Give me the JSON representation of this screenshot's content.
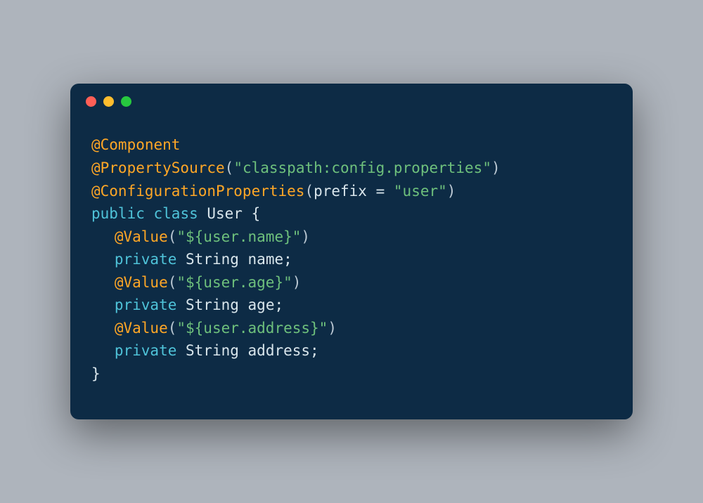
{
  "code": {
    "lines": [
      {
        "indent": 0,
        "tokens": [
          {
            "cls": "annotation",
            "t": "@Component"
          }
        ]
      },
      {
        "indent": 0,
        "tokens": [
          {
            "cls": "annotation",
            "t": "@PropertySource"
          },
          {
            "cls": "paren",
            "t": "("
          },
          {
            "cls": "string",
            "t": "\"classpath:config.properties\""
          },
          {
            "cls": "paren",
            "t": ")"
          }
        ]
      },
      {
        "indent": 0,
        "tokens": [
          {
            "cls": "annotation",
            "t": "@ConfigurationProperties"
          },
          {
            "cls": "paren",
            "t": "("
          },
          {
            "cls": "param",
            "t": "prefix "
          },
          {
            "cls": "op",
            "t": "= "
          },
          {
            "cls": "string",
            "t": "\"user\""
          },
          {
            "cls": "paren",
            "t": ")"
          }
        ]
      },
      {
        "indent": 0,
        "tokens": [
          {
            "cls": "keyword",
            "t": "public "
          },
          {
            "cls": "keyword",
            "t": "class "
          },
          {
            "cls": "type",
            "t": "User "
          },
          {
            "cls": "brace",
            "t": "{"
          }
        ]
      },
      {
        "indent": 1,
        "tokens": [
          {
            "cls": "annotation",
            "t": "@Value"
          },
          {
            "cls": "paren",
            "t": "("
          },
          {
            "cls": "string",
            "t": "\"${user.name}\""
          },
          {
            "cls": "paren",
            "t": ")"
          }
        ]
      },
      {
        "indent": 1,
        "tokens": [
          {
            "cls": "keyword",
            "t": "private "
          },
          {
            "cls": "type",
            "t": "String "
          },
          {
            "cls": "name",
            "t": "name;"
          }
        ]
      },
      {
        "indent": 1,
        "tokens": [
          {
            "cls": "annotation",
            "t": "@Value"
          },
          {
            "cls": "paren",
            "t": "("
          },
          {
            "cls": "string",
            "t": "\"${user.age}\""
          },
          {
            "cls": "paren",
            "t": ")"
          }
        ]
      },
      {
        "indent": 1,
        "tokens": [
          {
            "cls": "keyword",
            "t": "private "
          },
          {
            "cls": "type",
            "t": "String "
          },
          {
            "cls": "name",
            "t": "age;"
          }
        ]
      },
      {
        "indent": 1,
        "tokens": [
          {
            "cls": "annotation",
            "t": "@Value"
          },
          {
            "cls": "paren",
            "t": "("
          },
          {
            "cls": "string",
            "t": "\"${user.address}\""
          },
          {
            "cls": "paren",
            "t": ")"
          }
        ]
      },
      {
        "indent": 1,
        "tokens": [
          {
            "cls": "keyword",
            "t": "private "
          },
          {
            "cls": "type",
            "t": "String "
          },
          {
            "cls": "name",
            "t": "address;"
          }
        ]
      },
      {
        "indent": 0,
        "tokens": [
          {
            "cls": "brace",
            "t": "}"
          }
        ]
      }
    ]
  }
}
